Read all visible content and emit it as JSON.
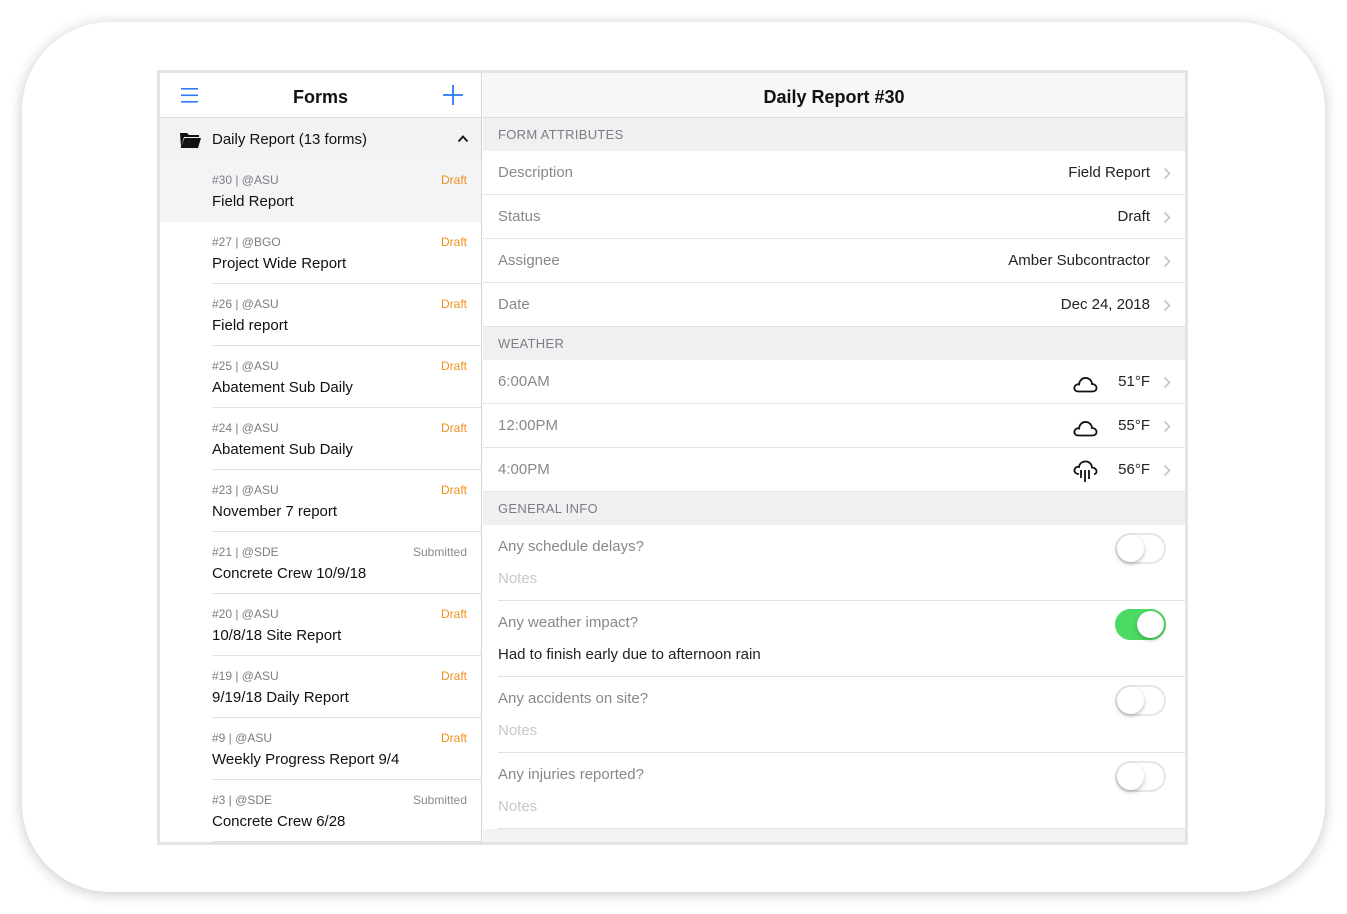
{
  "colors": {
    "draft": "#f0901e",
    "submitted": "#8a8a8f",
    "accent": "#2f7cf6",
    "toggle_on": "#4cd964"
  },
  "left_pane": {
    "title": "Forms",
    "menu_icon": "menu-icon",
    "add_icon": "plus-icon",
    "group": {
      "label": "Daily Report (13 forms)",
      "icon": "folder-icon",
      "expand_icon": "chevron-up-icon"
    },
    "forms": [
      {
        "meta": "#30 | @ASU",
        "title": "Field Report",
        "status": "Draft"
      },
      {
        "meta": "#27 | @BGO",
        "title": "Project Wide Report",
        "status": "Draft"
      },
      {
        "meta": "#26 | @ASU",
        "title": "Field report",
        "status": "Draft"
      },
      {
        "meta": "#25 | @ASU",
        "title": "Abatement Sub Daily",
        "status": "Draft"
      },
      {
        "meta": "#24 | @ASU",
        "title": "Abatement Sub Daily",
        "status": "Draft"
      },
      {
        "meta": "#23 | @ASU",
        "title": "November 7 report",
        "status": "Draft"
      },
      {
        "meta": "#21 | @SDE",
        "title": "Concrete Crew 10/9/18",
        "status": "Submitted"
      },
      {
        "meta": "#20 | @ASU",
        "title": "10/8/18 Site Report",
        "status": "Draft"
      },
      {
        "meta": "#19 | @ASU",
        "title": "9/19/18  Daily Report",
        "status": "Draft"
      },
      {
        "meta": "#9 | @ASU",
        "title": "Weekly Progress Report 9/4",
        "status": "Draft"
      },
      {
        "meta": "#3 | @SDE",
        "title": "Concrete Crew 6/28",
        "status": "Submitted"
      }
    ]
  },
  "right_pane": {
    "title": "Daily Report #30",
    "form_attributes": {
      "heading": "FORM ATTRIBUTES",
      "rows": [
        {
          "label": "Description",
          "value": "Field Report"
        },
        {
          "label": "Status",
          "value": "Draft"
        },
        {
          "label": "Assignee",
          "value": "Amber Subcontractor"
        },
        {
          "label": "Date",
          "value": "Dec 24, 2018"
        }
      ]
    },
    "weather": {
      "heading": "WEATHER",
      "rows": [
        {
          "time": "6:00AM",
          "icon": "cloud-icon",
          "temp": "51°F"
        },
        {
          "time": "12:00PM",
          "icon": "cloud-icon",
          "temp": "55°F"
        },
        {
          "time": "4:00PM",
          "icon": "rain-icon",
          "temp": "56°F"
        }
      ]
    },
    "general_info": {
      "heading": "GENERAL INFO",
      "rows": [
        {
          "question": "Any schedule delays?",
          "notes": "Notes",
          "on": false
        },
        {
          "question": "Any weather impact?",
          "notes": "Had to finish early due to afternoon rain",
          "on": true
        },
        {
          "question": "Any accidents on site?",
          "notes": "Notes",
          "on": false
        },
        {
          "question": "Any injuries reported?",
          "notes": "Notes",
          "on": false
        }
      ]
    }
  }
}
